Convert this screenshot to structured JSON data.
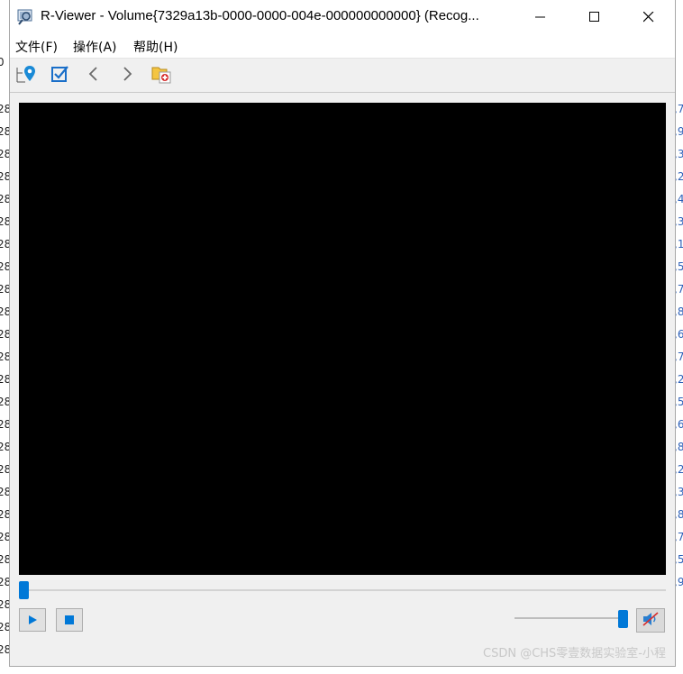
{
  "background": {
    "left_chars": [
      "0",
      "28",
      "28",
      "28",
      "28",
      "28",
      "28",
      "28",
      "28",
      "28",
      "28",
      "28",
      "28",
      "28",
      "28",
      "28",
      "28",
      "28",
      "28",
      "28",
      "28",
      "28",
      "28",
      "28",
      "28",
      "28"
    ],
    "right_chars": [
      ",7",
      ",9",
      ",3",
      ",2",
      ",4",
      ",3",
      ",1",
      ",5",
      ",7",
      ",8",
      ",6",
      ",7",
      ",2",
      ",5",
      ",6",
      ",8",
      ",2",
      ",3",
      ",8",
      ",7",
      ",5",
      ",9"
    ]
  },
  "window": {
    "title": "R-Viewer - Volume{7329a13b-0000-0000-004e-000000000000} (Recog...",
    "app_icon": "viewer-magnifier-icon",
    "caption_buttons": [
      "minimize-icon",
      "maximize-icon",
      "close-icon"
    ]
  },
  "menu": {
    "items": [
      "文件(F)",
      "操作(A)",
      "帮助(H)"
    ]
  },
  "toolbar": {
    "buttons": [
      "locate-map-pin-icon",
      "checkbox-checked-icon",
      "chevron-left-icon",
      "chevron-right-icon",
      "recover-folder-icon"
    ]
  },
  "player": {
    "seek_position": 0,
    "volume_level": 1.0,
    "muted": true,
    "controls": [
      "play-icon",
      "stop-icon"
    ],
    "accent_color": "#0078d7",
    "video_background": "#000000"
  },
  "watermark": "CSDN @CHS零壹数据实验室-小程"
}
